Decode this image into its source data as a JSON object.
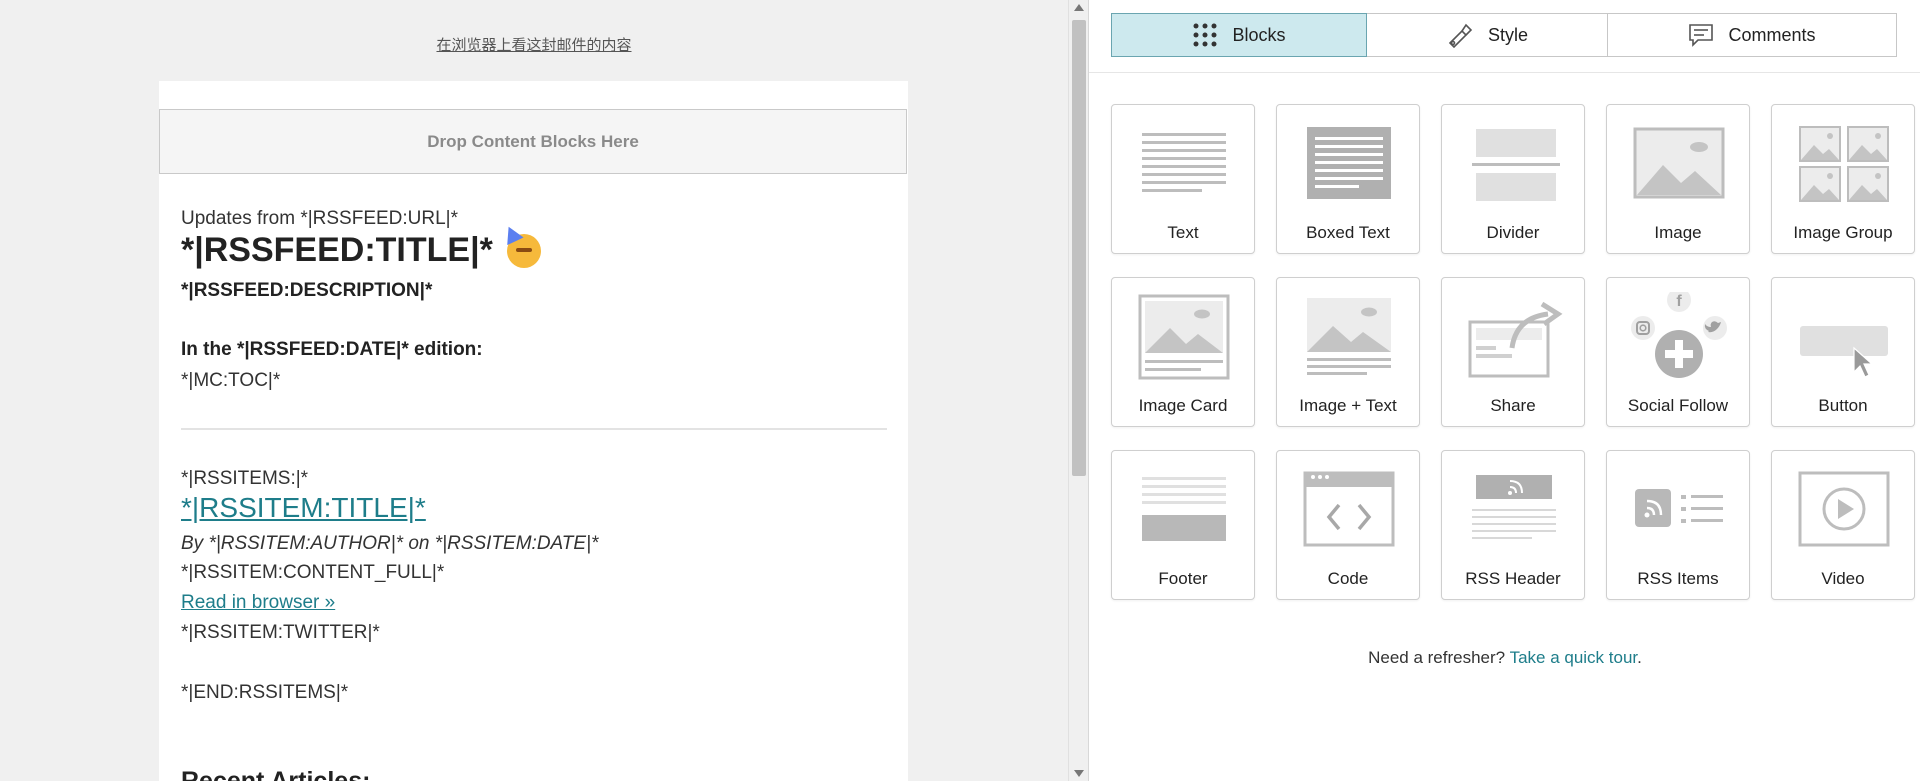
{
  "preview": {
    "view_in_browser": "在浏览器上看这封邮件的内容",
    "drop_zone": "Drop Content Blocks Here",
    "updates_line": "Updates from *|RSSFEED:URL|*",
    "feed_title": "*|RSSFEED:TITLE|*",
    "feed_description": "*|RSSFEED:DESCRIPTION|*",
    "edition_line": "In the *|RSSFEED:DATE|* edition:",
    "toc": "*|MC:TOC|*",
    "rss_items_open": "*|RSSITEMS:|*",
    "item_title": "*|RSSITEM:TITLE|*",
    "item_byline": "By *|RSSITEM:AUTHOR|* on *|RSSITEM:DATE|*",
    "item_content": "*|RSSITEM:CONTENT_FULL|*",
    "read_in_browser": "Read in browser »",
    "item_twitter": "*|RSSITEM:TWITTER|*",
    "rss_items_close": "*|END:RSSITEMS|*",
    "recent_articles": "Recent Articles:"
  },
  "panel": {
    "tabs": [
      {
        "label": "Blocks",
        "icon": "grid-icon",
        "active": true
      },
      {
        "label": "Style",
        "icon": "paint-brush-icon",
        "active": false
      },
      {
        "label": "Comments",
        "icon": "comment-icon",
        "active": false
      }
    ],
    "blocks": [
      {
        "label": "Text",
        "icon": "text-block-icon"
      },
      {
        "label": "Boxed Text",
        "icon": "boxed-text-icon"
      },
      {
        "label": "Divider",
        "icon": "divider-icon"
      },
      {
        "label": "Image",
        "icon": "image-icon"
      },
      {
        "label": "Image Group",
        "icon": "image-group-icon"
      },
      {
        "label": "Image Card",
        "icon": "image-card-icon"
      },
      {
        "label": "Image + Text",
        "icon": "image-text-icon"
      },
      {
        "label": "Share",
        "icon": "share-icon"
      },
      {
        "label": "Social Follow",
        "icon": "social-follow-icon"
      },
      {
        "label": "Button",
        "icon": "button-block-icon"
      },
      {
        "label": "Footer",
        "icon": "footer-icon"
      },
      {
        "label": "Code",
        "icon": "code-icon"
      },
      {
        "label": "RSS Header",
        "icon": "rss-header-icon"
      },
      {
        "label": "RSS Items",
        "icon": "rss-items-icon"
      },
      {
        "label": "Video",
        "icon": "video-icon"
      }
    ],
    "refresher_text": "Need a refresher?",
    "tour_link": "Take a quick tour",
    "refresher_end": "."
  },
  "colors": {
    "accent": "#1e7d8a",
    "active_tab_bg": "#cde9ee",
    "icon_gray": "#bdbdbd"
  }
}
